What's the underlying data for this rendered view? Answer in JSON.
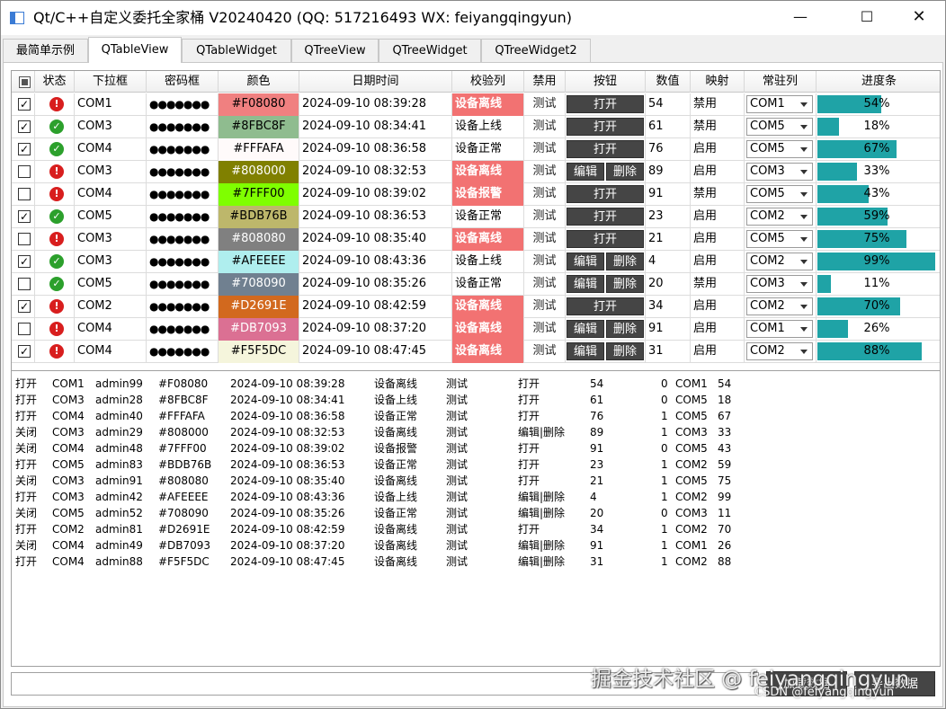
{
  "window": {
    "title": "Qt/C++自定义委托全家桶 V20240420 (QQ: 517216493 WX: feiyangqingyun)",
    "min_glyph": "—",
    "max_glyph": "☐",
    "close_glyph": "✕"
  },
  "tabs": [
    "最简单示例",
    "QTableView",
    "QTableWidget",
    "QTreeView",
    "QTreeWidget",
    "QTreeWidget2"
  ],
  "active_tab": "QTableView",
  "table": {
    "headers": [
      "状态",
      "下拉框",
      "密码框",
      "颜色",
      "日期时间",
      "校验列",
      "禁用",
      "按钮",
      "数值",
      "映射",
      "常驻列",
      "进度条"
    ],
    "rows": [
      {
        "checked": true,
        "status": "error",
        "combo": "COM1",
        "password": "●●●●●●●",
        "color": "#F08080",
        "datetime": "2024-09-10 08:39:28",
        "check": "设备离线",
        "check_alert": true,
        "disabled": "测试",
        "buttons": [
          "打开"
        ],
        "value": "54",
        "mapping": "禁用",
        "resident": "COM1",
        "progress": 54
      },
      {
        "checked": true,
        "status": "ok",
        "combo": "COM3",
        "password": "●●●●●●●",
        "color": "#8FBC8F",
        "datetime": "2024-09-10 08:34:41",
        "check": "设备上线",
        "check_alert": false,
        "disabled": "测试",
        "buttons": [
          "打开"
        ],
        "value": "61",
        "mapping": "禁用",
        "resident": "COM5",
        "progress": 18
      },
      {
        "checked": true,
        "status": "ok",
        "combo": "COM4",
        "password": "●●●●●●●",
        "color": "#FFFAFA",
        "datetime": "2024-09-10 08:36:58",
        "check": "设备正常",
        "check_alert": false,
        "disabled": "测试",
        "buttons": [
          "打开"
        ],
        "value": "76",
        "mapping": "启用",
        "resident": "COM5",
        "progress": 67
      },
      {
        "checked": false,
        "status": "error",
        "combo": "COM3",
        "password": "●●●●●●●",
        "color": "#808000",
        "datetime": "2024-09-10 08:32:53",
        "check": "设备离线",
        "check_alert": true,
        "disabled": "测试",
        "buttons": [
          "编辑",
          "删除"
        ],
        "value": "89",
        "mapping": "启用",
        "resident": "COM3",
        "progress": 33
      },
      {
        "checked": false,
        "status": "error",
        "combo": "COM4",
        "password": "●●●●●●●",
        "color": "#7FFF00",
        "datetime": "2024-09-10 08:39:02",
        "check": "设备报警",
        "check_alert": true,
        "disabled": "测试",
        "buttons": [
          "打开"
        ],
        "value": "91",
        "mapping": "禁用",
        "resident": "COM5",
        "progress": 43
      },
      {
        "checked": true,
        "status": "ok",
        "combo": "COM5",
        "password": "●●●●●●●",
        "color": "#BDB76B",
        "datetime": "2024-09-10 08:36:53",
        "check": "设备正常",
        "check_alert": false,
        "disabled": "测试",
        "buttons": [
          "打开"
        ],
        "value": "23",
        "mapping": "启用",
        "resident": "COM2",
        "progress": 59
      },
      {
        "checked": false,
        "status": "error",
        "combo": "COM3",
        "password": "●●●●●●●",
        "color": "#808080",
        "datetime": "2024-09-10 08:35:40",
        "check": "设备离线",
        "check_alert": true,
        "disabled": "测试",
        "buttons": [
          "打开"
        ],
        "value": "21",
        "mapping": "启用",
        "resident": "COM5",
        "progress": 75
      },
      {
        "checked": true,
        "status": "ok",
        "combo": "COM3",
        "password": "●●●●●●●",
        "color": "#AFEEEE",
        "datetime": "2024-09-10 08:43:36",
        "check": "设备上线",
        "check_alert": false,
        "disabled": "测试",
        "buttons": [
          "编辑",
          "删除"
        ],
        "value": "4",
        "mapping": "启用",
        "resident": "COM2",
        "progress": 99
      },
      {
        "checked": false,
        "status": "ok",
        "combo": "COM5",
        "password": "●●●●●●●",
        "color": "#708090",
        "datetime": "2024-09-10 08:35:26",
        "check": "设备正常",
        "check_alert": false,
        "disabled": "测试",
        "buttons": [
          "编辑",
          "删除"
        ],
        "value": "20",
        "mapping": "禁用",
        "resident": "COM3",
        "progress": 11
      },
      {
        "checked": true,
        "status": "error",
        "combo": "COM2",
        "password": "●●●●●●●",
        "color": "#D2691E",
        "datetime": "2024-09-10 08:42:59",
        "check": "设备离线",
        "check_alert": true,
        "disabled": "测试",
        "buttons": [
          "打开"
        ],
        "value": "34",
        "mapping": "启用",
        "resident": "COM2",
        "progress": 70
      },
      {
        "checked": false,
        "status": "error",
        "combo": "COM4",
        "password": "●●●●●●●",
        "color": "#DB7093",
        "datetime": "2024-09-10 08:37:20",
        "check": "设备离线",
        "check_alert": true,
        "disabled": "测试",
        "buttons": [
          "编辑",
          "删除"
        ],
        "value": "91",
        "mapping": "启用",
        "resident": "COM1",
        "progress": 26
      },
      {
        "checked": true,
        "status": "error",
        "combo": "COM4",
        "password": "●●●●●●●",
        "color": "#F5F5DC",
        "datetime": "2024-09-10 08:47:45",
        "check": "设备离线",
        "check_alert": true,
        "disabled": "测试",
        "buttons": [
          "编辑",
          "删除"
        ],
        "value": "31",
        "mapping": "启用",
        "resident": "COM2",
        "progress": 88
      }
    ]
  },
  "log": [
    [
      "打开",
      "COM1",
      "admin99",
      "#F08080",
      "2024-09-10 08:39:28",
      "设备离线",
      "测试",
      "打开",
      "54",
      "0",
      "COM1",
      "54"
    ],
    [
      "打开",
      "COM3",
      "admin28",
      "#8FBC8F",
      "2024-09-10 08:34:41",
      "设备上线",
      "测试",
      "打开",
      "61",
      "0",
      "COM5",
      "18"
    ],
    [
      "打开",
      "COM4",
      "admin40",
      "#FFFAFA",
      "2024-09-10 08:36:58",
      "设备正常",
      "测试",
      "打开",
      "76",
      "1",
      "COM5",
      "67"
    ],
    [
      "关闭",
      "COM3",
      "admin29",
      "#808000",
      "2024-09-10 08:32:53",
      "设备离线",
      "测试",
      "编辑|删除",
      "89",
      "1",
      "COM3",
      "33"
    ],
    [
      "关闭",
      "COM4",
      "admin48",
      "#7FFF00",
      "2024-09-10 08:39:02",
      "设备报警",
      "测试",
      "打开",
      "91",
      "0",
      "COM5",
      "43"
    ],
    [
      "打开",
      "COM5",
      "admin83",
      "#BDB76B",
      "2024-09-10 08:36:53",
      "设备正常",
      "测试",
      "打开",
      "23",
      "1",
      "COM2",
      "59"
    ],
    [
      "关闭",
      "COM3",
      "admin91",
      "#808080",
      "2024-09-10 08:35:40",
      "设备离线",
      "测试",
      "打开",
      "21",
      "1",
      "COM5",
      "75"
    ],
    [
      "打开",
      "COM3",
      "admin42",
      "#AFEEEE",
      "2024-09-10 08:43:36",
      "设备上线",
      "测试",
      "编辑|删除",
      "4",
      "1",
      "COM2",
      "99"
    ],
    [
      "关闭",
      "COM5",
      "admin52",
      "#708090",
      "2024-09-10 08:35:26",
      "设备正常",
      "测试",
      "编辑|删除",
      "20",
      "0",
      "COM3",
      "11"
    ],
    [
      "打开",
      "COM2",
      "admin81",
      "#D2691E",
      "2024-09-10 08:42:59",
      "设备离线",
      "测试",
      "打开",
      "34",
      "1",
      "COM2",
      "70"
    ],
    [
      "关闭",
      "COM4",
      "admin49",
      "#DB7093",
      "2024-09-10 08:37:20",
      "设备离线",
      "测试",
      "编辑|删除",
      "91",
      "1",
      "COM1",
      "26"
    ],
    [
      "打开",
      "COM4",
      "admin88",
      "#F5F5DC",
      "2024-09-10 08:47:45",
      "设备离线",
      "测试",
      "编辑|删除",
      "31",
      "1",
      "COM2",
      "88"
    ]
  ],
  "bottom": {
    "input_value": "",
    "button1": "加载数据",
    "button2": "导出数据"
  },
  "watermark": {
    "main": "掘金技术社区 @ feiyangqingyun",
    "sub": "CSDN @feiyangqingyun"
  },
  "colors": {
    "accent_progress": "#1fa3a6",
    "alert_red": "#f27272",
    "button_dark": "#454545"
  }
}
